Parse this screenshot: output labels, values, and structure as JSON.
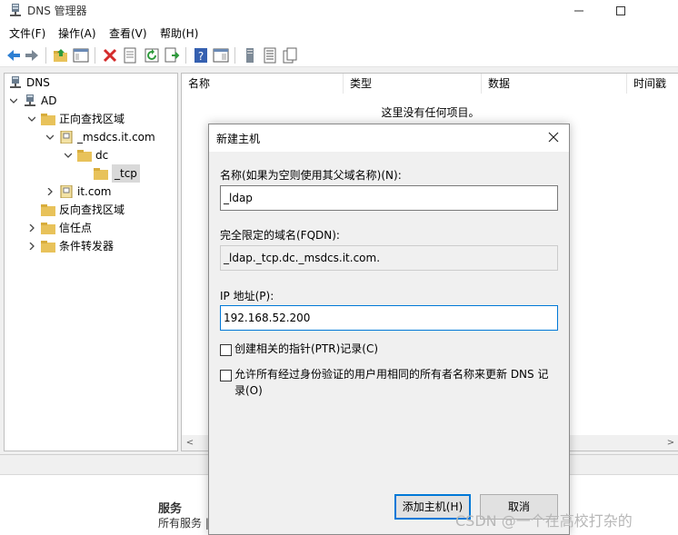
{
  "window": {
    "title": "DNS 管理器",
    "minimize": "—",
    "maximize": "☐"
  },
  "menu": {
    "file": "文件(F)",
    "action": "操作(A)",
    "view": "查看(V)",
    "help": "帮助(H)"
  },
  "tree": {
    "root": "DNS",
    "server": "AD",
    "forward_zones": "正向查找区域",
    "msdcs_zone": "_msdcs.it.com",
    "dc": "dc",
    "tcp": "_tcp",
    "it_zone": "it.com",
    "reverse_zones": "反向查找区域",
    "trust_points": "信任点",
    "forwarders": "条件转发器"
  },
  "list": {
    "columns": [
      "名称",
      "类型",
      "数据",
      "时间戳"
    ],
    "empty": "这里没有任何项目。"
  },
  "bottom": {
    "title": "服务",
    "subtitle": "所有服务 |"
  },
  "dialog": {
    "title": "新建主机",
    "name_label": "名称(如果为空则使用其父域名称)(N):",
    "name_value": "_ldap",
    "fqdn_label": "完全限定的域名(FQDN):",
    "fqdn_value": "_ldap._tcp.dc._msdcs.it.com.",
    "ip_label": "IP 地址(P):",
    "ip_value": "192.168.52.200",
    "ptr_label": "创建相关的指针(PTR)记录(C)",
    "allow_label_line1": "允许所有经过身份验证的用户用相同的所有者名称来更新 DNS 记",
    "allow_label_line2": "录(O)",
    "add_button": "添加主机(H)",
    "cancel_button": "取消"
  },
  "watermark": "CSDN @一个在高校打杂的",
  "colors": {
    "accent": "#0078d7",
    "folder": "#e8c25a"
  }
}
